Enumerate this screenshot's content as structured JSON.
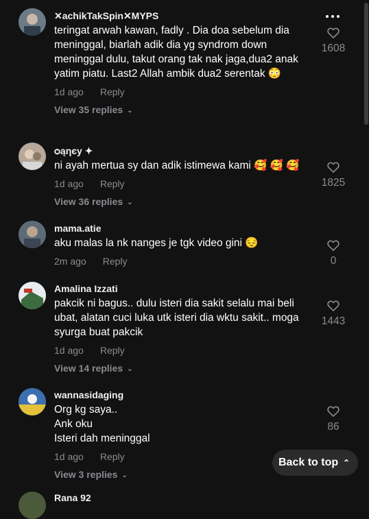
{
  "comments": [
    {
      "username": "✕achikTakSpin✕MYPS",
      "text": "teringat arwah kawan, fadly . Dia doa sebelum dia meninggal, biarlah adik dia yg syndrom down meninggal dulu, takut orang tak nak jaga,dua2 anak yatim piatu. Last2 Allah ambik dua2 serentak 😳",
      "time": "1d ago",
      "reply_label": "Reply",
      "view_replies": "View 35 replies",
      "likes": "1608",
      "avatar_color": "#6b7c87"
    },
    {
      "username": "ѻąηєу ✦",
      "text": "ni ayah mertua sy dan adik istimewa kami 🥰 🥰 🥰",
      "time": "1d ago",
      "reply_label": "Reply",
      "view_replies": "View 36 replies",
      "likes": "1825",
      "avatar_color": "#b8a89a"
    },
    {
      "username": "mama.atie",
      "text": "aku malas la nk nanges je tgk video gini 😔",
      "time": "2m ago",
      "reply_label": "Reply",
      "likes": "0",
      "avatar_color": "#5e6a78"
    },
    {
      "username": "Amalina Izzati",
      "text": "pakcik ni bagus.. dulu isteri dia sakit selalu mai beli ubat, alatan cuci luka utk isteri dia wktu sakit.. moga syurga buat pakcik",
      "time": "1d ago",
      "reply_label": "Reply",
      "view_replies": "View 14 replies",
      "likes": "1443",
      "avatar_color": "#3c6b3f"
    },
    {
      "username": "wannasidaging",
      "text": "Org kg saya..\nAnk oku\nIsteri dah meninggal",
      "time": "1d ago",
      "reply_label": "Reply",
      "view_replies": "View 3 replies",
      "likes": "86",
      "avatar_color": "#3b6fb0"
    }
  ],
  "partial_next_username": "Rana 92",
  "back_to_top_label": "Back to top",
  "more_icon": "more-horizontal-icon",
  "colors": {
    "background": "#121212",
    "muted": "#8a8b91",
    "text": "#ffffff"
  }
}
